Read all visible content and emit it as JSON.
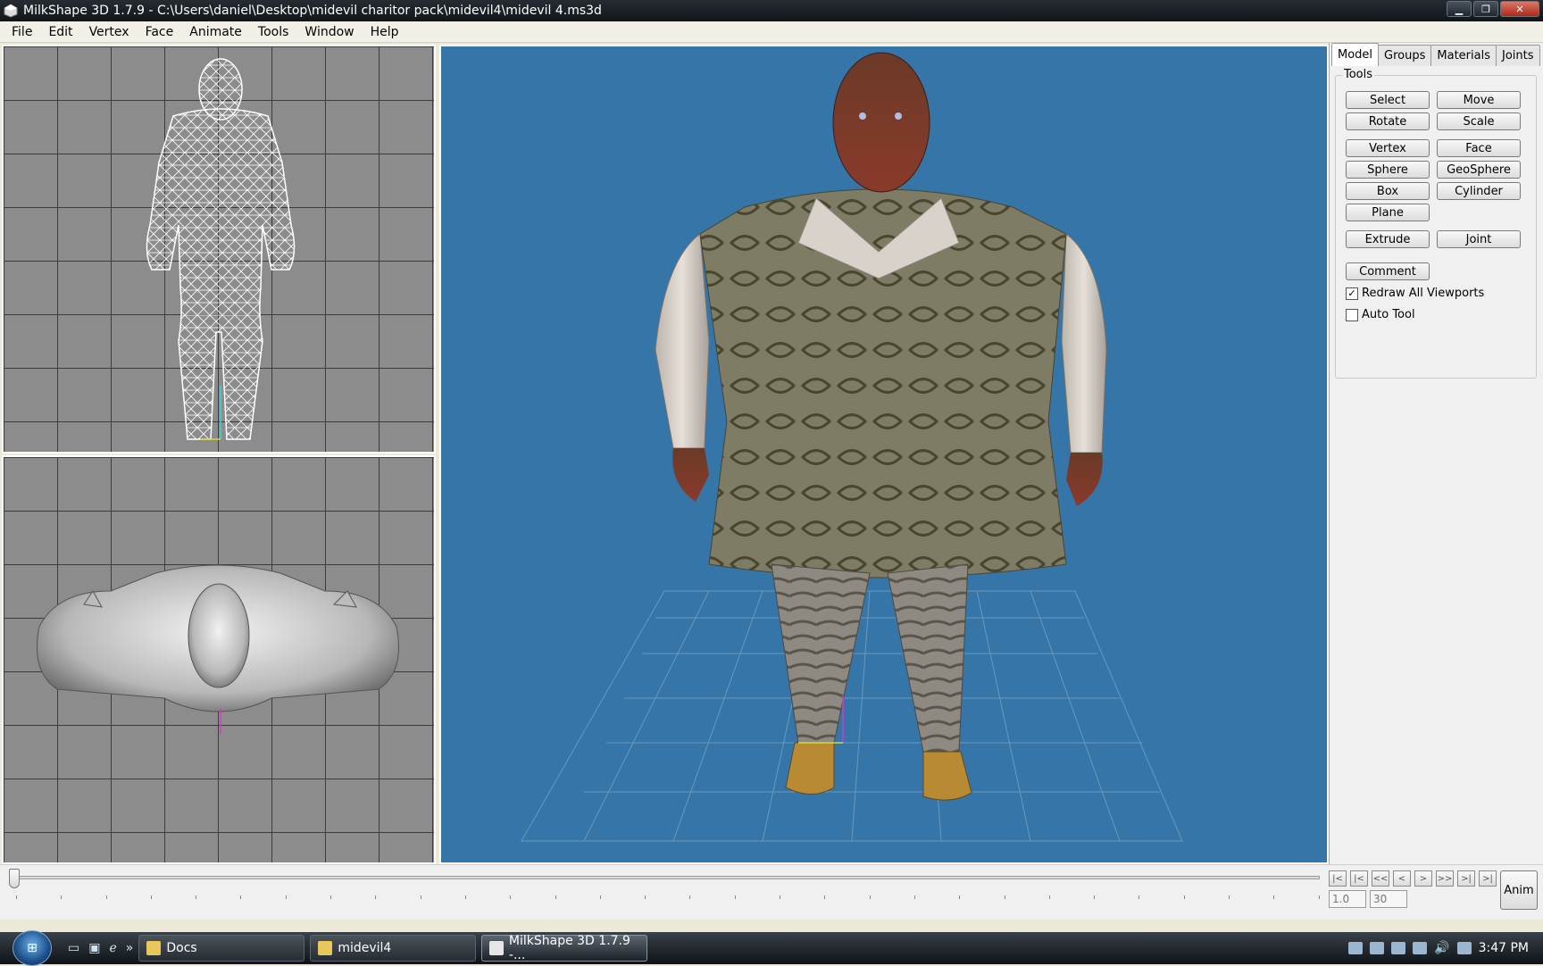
{
  "window": {
    "title": "MilkShape 3D 1.7.9 - C:\\Users\\daniel\\Desktop\\midevil charitor pack\\midevil4\\midevil 4.ms3d"
  },
  "menu": [
    "File",
    "Edit",
    "Vertex",
    "Face",
    "Animate",
    "Tools",
    "Window",
    "Help"
  ],
  "panel": {
    "tabs": [
      "Model",
      "Groups",
      "Materials",
      "Joints"
    ],
    "group_label": "Tools",
    "buttons": {
      "select": "Select",
      "move": "Move",
      "rotate": "Rotate",
      "scale": "Scale",
      "vertex": "Vertex",
      "face": "Face",
      "sphere": "Sphere",
      "geosphere": "GeoSphere",
      "box": "Box",
      "cylinder": "Cylinder",
      "plane": "Plane",
      "extrude": "Extrude",
      "joint": "Joint",
      "comment": "Comment"
    },
    "checks": [
      {
        "label": "Redraw All Viewports",
        "checked": true
      },
      {
        "label": "Auto Tool",
        "checked": false
      }
    ]
  },
  "timeline": {
    "buttons": [
      "|<",
      "|<",
      "<<",
      "<",
      ">",
      ">>",
      ">|",
      ">|"
    ],
    "current_frame": "1.0",
    "total_frames": "30",
    "anim_button": "Anim"
  },
  "taskbar": {
    "tasks": [
      "Docs",
      "midevil4",
      "MilkShape 3D 1.7.9 -..."
    ],
    "clock": "3:47 PM"
  },
  "colors": {
    "viewport_3d": "#3575a8",
    "viewport_2d": "#8c8c8c"
  }
}
